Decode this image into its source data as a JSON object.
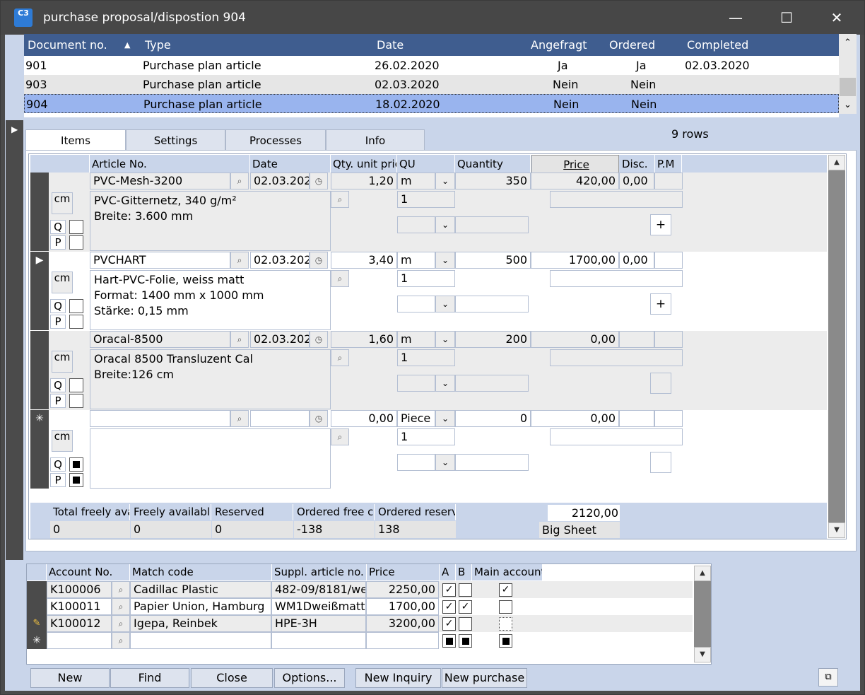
{
  "window": {
    "title": "purchase proposal/dispostion 904",
    "app_icon": "C3"
  },
  "top_table": {
    "columns": [
      "Document no.",
      "Type",
      "Date",
      "Angefragt",
      "Ordered",
      "Completed"
    ],
    "rows": [
      {
        "doc": "901",
        "type": "Purchase plan article",
        "date": "26.02.2020",
        "angefragt": "Ja",
        "ordered": "Ja",
        "completed": "02.03.2020"
      },
      {
        "doc": "903",
        "type": "Purchase plan article",
        "date": "02.03.2020",
        "angefragt": "Nein",
        "ordered": "Nein",
        "completed": ""
      },
      {
        "doc": "904",
        "type": "Purchase plan article",
        "date": "18.02.2020",
        "angefragt": "Nein",
        "ordered": "Nein",
        "completed": ""
      }
    ],
    "selected_row": "904",
    "sort_indicator": "▲"
  },
  "tabs": [
    "Items",
    "Settings",
    "Processes",
    "Info"
  ],
  "active_tab": "Items",
  "row_count": "9 rows",
  "items_grid": {
    "columns": [
      "Article No.",
      "Date",
      "Qty. unit pric",
      "QU",
      "Quantity",
      "Price",
      "Disc.",
      "P.M"
    ],
    "rows": [
      {
        "article": "PVC-Mesh-3200",
        "date": "02.03.202",
        "unit_price": "1,20",
        "qu": "m",
        "quantity": "350",
        "price": "420,00",
        "disc": "0,00",
        "desc": "PVC-Gitternetz, 340 g/m²\nBreite: 3.600 mm",
        "qty2": "1",
        "cm": "cm",
        "q": "Q",
        "p": "P",
        "plus": "+"
      },
      {
        "article": "PVCHART",
        "date": "02.03.202",
        "unit_price": "3,40",
        "qu": "m",
        "quantity": "500",
        "price": "1700,00",
        "disc": "0,00",
        "desc": "Hart-PVC-Folie, weiss matt\nFormat: 1400 mm x 1000 mm\nStärke: 0,15 mm",
        "qty2": "1",
        "cm": "cm",
        "q": "Q",
        "p": "P",
        "plus": "+"
      },
      {
        "article": "Oracal-8500",
        "date": "02.03.202",
        "unit_price": "1,60",
        "qu": "m",
        "quantity": "200",
        "price": "0,00",
        "disc": "",
        "desc": "Oracal 8500 Transluzent Cal\nBreite:126 cm",
        "qty2": "1",
        "cm": "cm",
        "q": "Q",
        "p": "P",
        "plus": ""
      },
      {
        "article": "",
        "date": "",
        "unit_price": "0,00",
        "qu": "Piece",
        "quantity": "0",
        "price": "0,00",
        "disc": "",
        "desc": "",
        "qty2": "1",
        "cm": "cm",
        "q": "Q",
        "p": "P",
        "plus": ""
      }
    ],
    "new_row_marker": "✳",
    "current_row_marker": "▶"
  },
  "summary": {
    "labels": [
      "Total freely ava",
      "Freely available",
      "Reserved",
      "Ordered free ca",
      "Ordered reserv"
    ],
    "values": [
      "0",
      "0",
      "0",
      "-138",
      "138"
    ],
    "total": "2120,00",
    "unit_name": "Big Sheet"
  },
  "accounts": {
    "columns": [
      "Account No.",
      "Match code",
      "Suppl. article no.",
      "Price",
      "A",
      "B",
      "Main account"
    ],
    "rows": [
      {
        "account": "K100006",
        "match": "Cadillac Plastic",
        "suppl": "482-09/8181/we",
        "price": "2250,00",
        "a": true,
        "b": false,
        "main": true
      },
      {
        "account": "K100011",
        "match": "Papier Union, Hamburg",
        "suppl": "WM1Dweißmatt",
        "price": "1700,00",
        "a": true,
        "b": true,
        "main": false
      },
      {
        "account": "K100012",
        "match": "Igepa, Reinbek",
        "suppl": "HPE-3H",
        "price": "3200,00",
        "a": true,
        "b": false,
        "main": false
      }
    ]
  },
  "buttons": {
    "new": "New",
    "find": "Find",
    "close": "Close",
    "options": "Options...",
    "new_inquiry": "New Inquiry",
    "new_purchase": "New purchase"
  }
}
